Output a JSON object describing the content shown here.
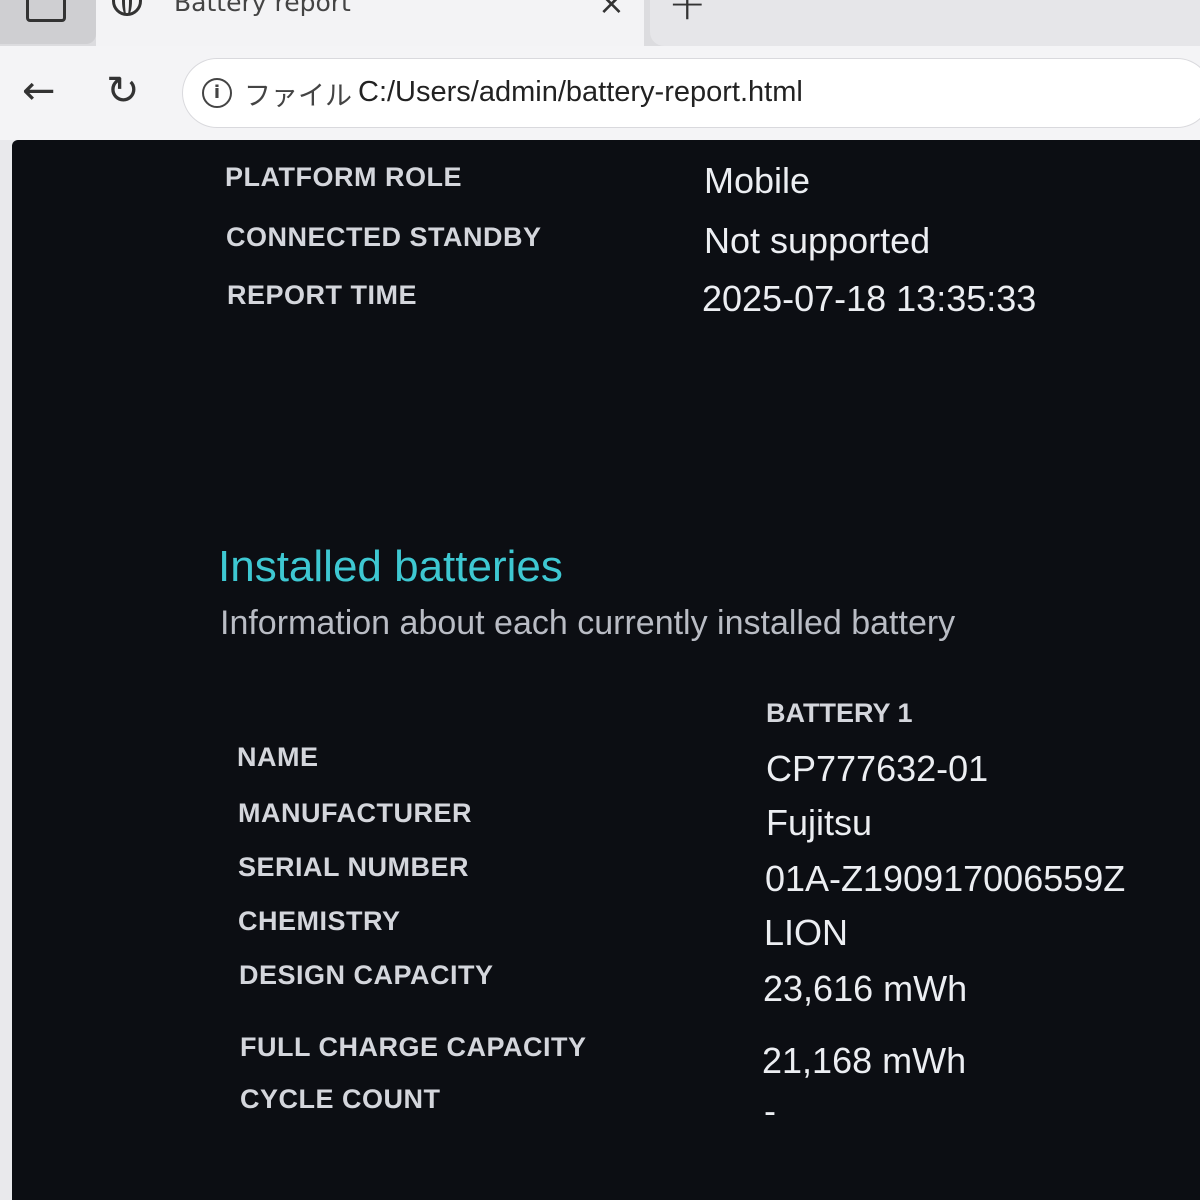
{
  "browser": {
    "tab_title": "Battery report",
    "close_tab_glyph": "×",
    "new_tab_glyph": "+",
    "back_glyph": "←",
    "reload_glyph": "↻",
    "info_glyph": "i",
    "address_prefix": "ファイル",
    "url": "C:/Users/admin/battery-report.html"
  },
  "system_info": [
    {
      "label": "PLATFORM ROLE",
      "value": "Mobile"
    },
    {
      "label": "CONNECTED STANDBY",
      "value": "Not supported"
    },
    {
      "label": "REPORT TIME",
      "value": "2025-07-18  13:35:33"
    }
  ],
  "installed_batteries": {
    "title": "Installed batteries",
    "subtitle": "Information about each currently installed battery",
    "column_header": "BATTERY 1",
    "rows": [
      {
        "label": "NAME",
        "value": "CP777632-01"
      },
      {
        "label": "MANUFACTURER",
        "value": "Fujitsu"
      },
      {
        "label": "SERIAL NUMBER",
        "value": "01A-Z190917006559Z"
      },
      {
        "label": "CHEMISTRY",
        "value": "LION"
      },
      {
        "label": "DESIGN CAPACITY",
        "value": "23,616 mWh"
      },
      {
        "label": "FULL CHARGE CAPACITY",
        "value": "21,168 mWh"
      },
      {
        "label": "CYCLE COUNT",
        "value": "-"
      }
    ]
  },
  "colors": {
    "page_background": "#0c0e13",
    "heading_accent": "#3ec8d2",
    "text": "#eceef2"
  }
}
